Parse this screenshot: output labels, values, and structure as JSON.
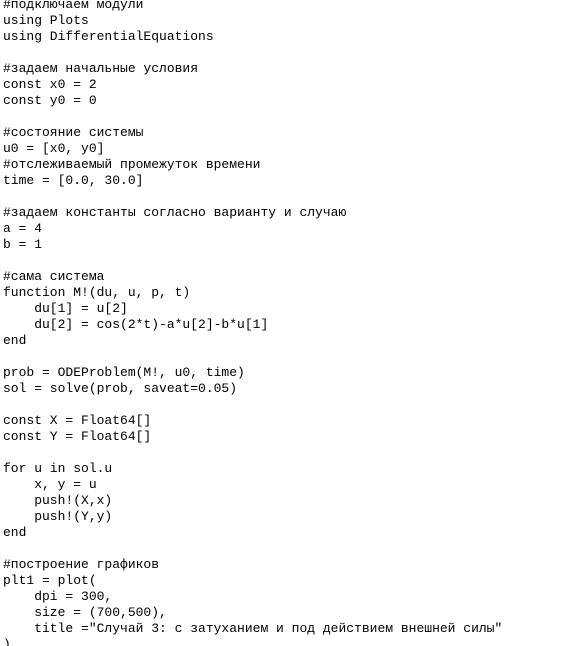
{
  "editor": {
    "lines": [
      "#подключаем модули",
      "using Plots",
      "using DifferentialEquations",
      "",
      "#задаем начальные условия",
      "const x0 = 2",
      "const y0 = 0",
      "",
      "#состояние системы",
      "u0 = [x0, y0]",
      "#отслеживаемый промежуток времени",
      "time = [0.0, 30.0]",
      "",
      "#задаем константы согласно варианту и случаю",
      "a = 4",
      "b = 1",
      "",
      "#сама система",
      "function M!(du, u, p, t)",
      "    du[1] = u[2]",
      "    du[2] = cos(2*t)-a*u[2]-b*u[1]",
      "end",
      "",
      "prob = ODEProblem(M!, u0, time)",
      "sol = solve(prob, saveat=0.05)",
      "",
      "const X = Float64[]",
      "const Y = Float64[]",
      "",
      "for u in sol.u",
      "    x, y = u",
      "    push!(X,x)",
      "    push!(Y,y)",
      "end",
      "",
      "#построение графиков",
      "plt1 = plot(",
      "    dpi = 300,",
      "    size = (700,500),",
      "    title =\"Случай 3: с затуханием и под действием внешней силы\"",
      ")"
    ]
  }
}
